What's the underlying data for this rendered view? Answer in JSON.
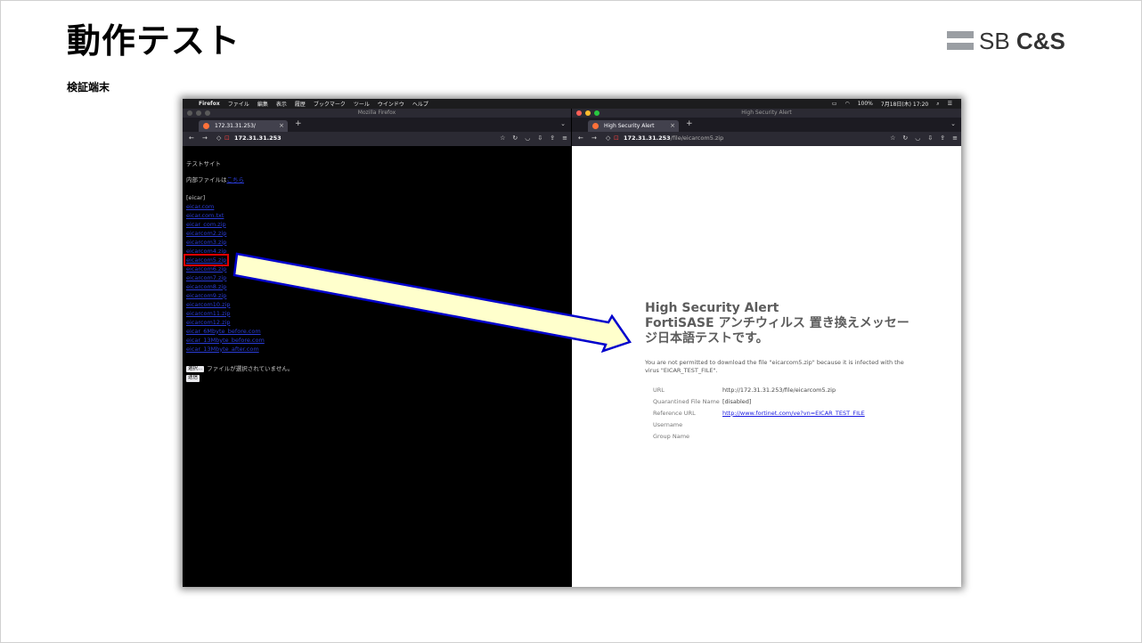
{
  "slide": {
    "title": "動作テスト",
    "subtitle": "検証端末",
    "logo_bold": "C&S",
    "logo_prefix": "SB "
  },
  "menubar": {
    "items": [
      "Firefox",
      "ファイル",
      "編集",
      "表示",
      "履歴",
      "ブックマーク",
      "ツール",
      "ウインドウ",
      "ヘルプ"
    ],
    "battery": "100%",
    "datetime": "7月18日(木) 17:20"
  },
  "left_window": {
    "window_title": "Mozilla Firefox",
    "tab_title": "172.31.31.253/",
    "address": "172.31.31.253",
    "page": {
      "site_title": "テストサイト",
      "internal_text": "内部ファイルは",
      "internal_link": "こちら",
      "eicar_heading": "[eicar]",
      "links": [
        "eicar.com",
        "eicar.com.txt",
        "eicar_com.zip",
        "eicarcom2.zip",
        "eicarcom3.zip",
        "eicarcom4.zip",
        "eicarcom5.zip",
        "eicarcom6.zip",
        "eicarcom7.zip",
        "eicarcom8.zip",
        "eicarcom9.zip",
        "eicarcom10.zip",
        "eicarcom11.zip",
        "eicarcom12.zip",
        "eicar_6Mbyte_before.com",
        "eicar_13Mbyte_before.com",
        "eicar_13Mbyte_after.com"
      ],
      "highlighted_link": "eicarcom5.zip",
      "choose_button": "選択...",
      "no_file_text": "ファイルが選択されていません。",
      "submit_button": "送信"
    }
  },
  "right_window": {
    "window_title": "High Security Alert",
    "tab_title": "High Security Alert",
    "address_host": "172.31.31.253",
    "address_path": "/file/eicarcom5.zip",
    "alert": {
      "heading_line1": "High Security Alert",
      "heading_line2": "FortiSASE アンチウィルス 置き換えメッセージ日本語テストです。",
      "message": "You are not permitted to download the file \"eicarcom5.zip\" because it is infected with the virus \"EICAR_TEST_FILE\".",
      "details": [
        {
          "key": "URL",
          "value": "http://172.31.31.253/file/eicarcom5.zip"
        },
        {
          "key": "Quarantined File Name",
          "value": "[disabled]"
        },
        {
          "key": "Reference URL",
          "value": "http://www.fortinet.com/ve?vn=EICAR_TEST_FILE",
          "link": true
        },
        {
          "key": "Username",
          "value": ""
        },
        {
          "key": "Group Name",
          "value": ""
        }
      ]
    }
  },
  "colors": {
    "highlight_box": "#e00000",
    "arrow_fill": "#ffffcc",
    "arrow_stroke": "#0000cc",
    "link": "#2a3cd6"
  }
}
